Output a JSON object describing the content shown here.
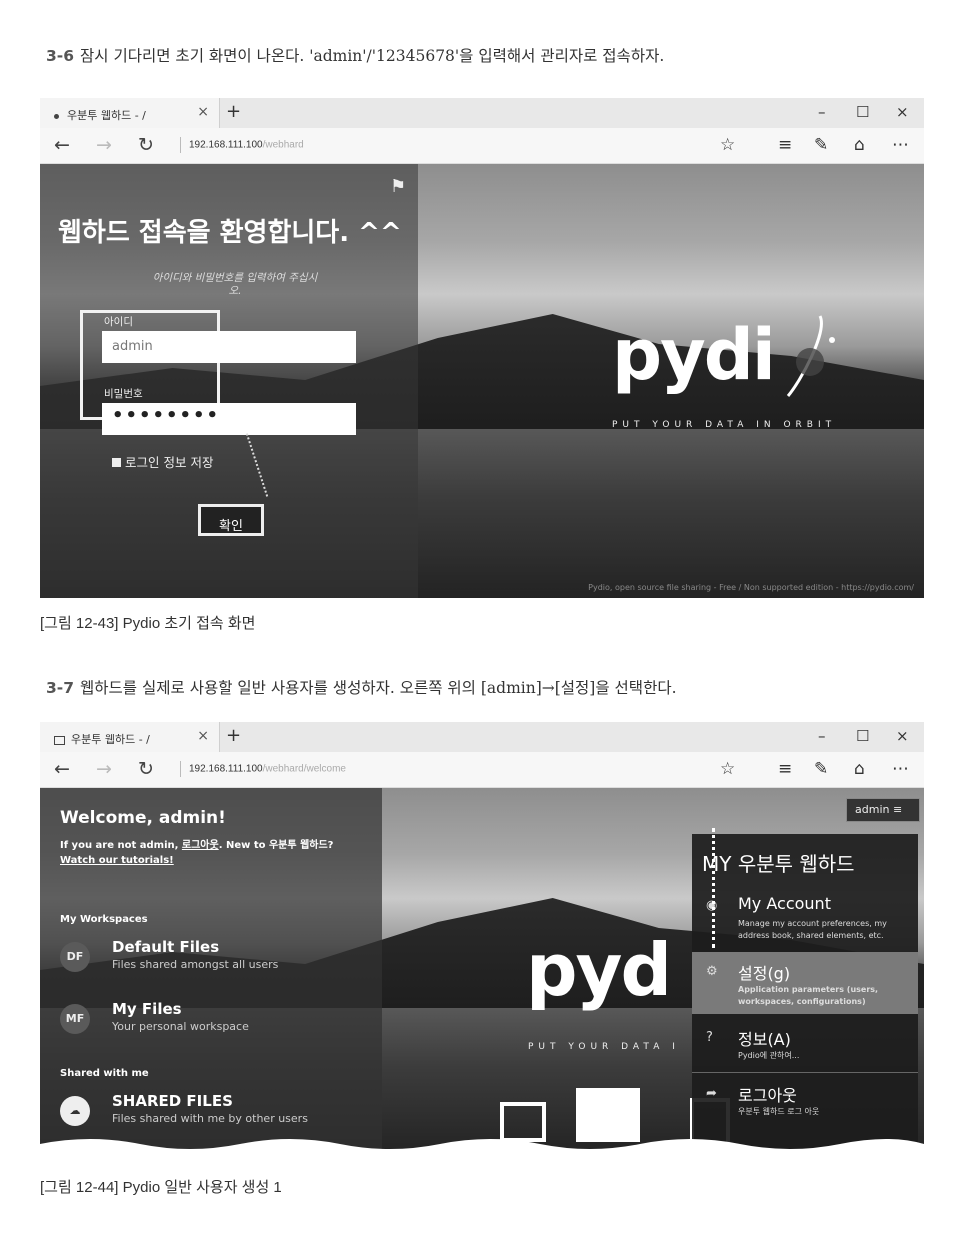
{
  "step1": {
    "num": "3-6",
    "text": "잠시 기다리면 초기 화면이 나온다. 'admin'/'12345678'을 입력해서 관리자로 접속하자."
  },
  "screen1": {
    "tab_title": "우분투 웹하드 - /",
    "tab_close": "×",
    "new_tab": "+",
    "win_min": "–",
    "win_max": "☐",
    "win_close": "×",
    "addr_host": "192.168.111.100",
    "addr_path": "/webhard",
    "heading": "웹하드 접속을 환영합니다. ^^",
    "hint": "아이디와 비밀번호를 입력하여 주십시오.",
    "id_label": "아이디",
    "id_value": "admin",
    "pw_label": "비밀번호",
    "pw_value": "••••••••",
    "remember_label": "로그인 정보 저장",
    "ok_label": "확인",
    "logo": "pydi",
    "tagline": "PUT YOUR DATA IN ORBIT",
    "footer": "Pydio, open source file sharing - Free / Non supported edition - https://pydio.com/"
  },
  "caption1": "[그림 12-43] Pydio 초기 접속 화면",
  "step2": {
    "num": "3-7",
    "text": "웹하드를 실제로 사용할 일반 사용자를 생성하자. 오른쪽 위의 [admin]→[설정]을 선택한다."
  },
  "screen2": {
    "tab_title": "우분투 웹하드 - /",
    "addr_host": "192.168.111.100",
    "addr_path": "/webhard/welcome",
    "welcome": "Welcome, admin!",
    "notice_pre": "If you are not admin, ",
    "notice_link": "로그아웃",
    "notice_post": ". New to 우분투 웹하드?",
    "tutorials": "Watch our tutorials!",
    "my_workspaces": "My Workspaces",
    "workspaces": [
      {
        "badge": "DF",
        "name": "Default Files",
        "desc": "Files shared amongst all users"
      },
      {
        "badge": "MF",
        "name": "My Files",
        "desc": "Your personal workspace"
      }
    ],
    "shared_with_me": "Shared with me",
    "shared_name": "SHARED FILES",
    "shared_desc": "Files shared with me by other users",
    "logo": "pyd",
    "tagline": "PUT YOUR DATA I",
    "admin_btn": "admin",
    "menu_title": "MY 우분투 웹하드",
    "menu": [
      {
        "title": "My Account",
        "desc": "Manage my account preferences, my address book, shared elements, etc."
      },
      {
        "title": "설정(g)",
        "desc": "Application parameters (users, workspaces, configurations)"
      },
      {
        "title": "정보(A)",
        "desc": "Pydio에 관하여..."
      },
      {
        "title": "로그아웃",
        "desc": "우분투 웹하드 로그 아웃"
      }
    ]
  },
  "caption2": "[그림 12-44] Pydio 일반 사용자 생성 1"
}
